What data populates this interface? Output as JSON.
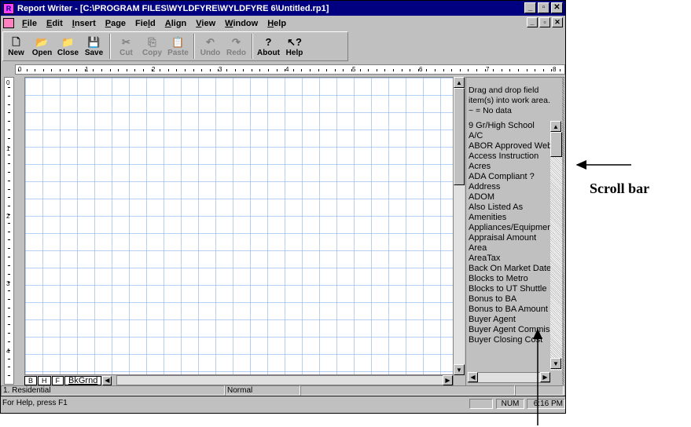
{
  "window": {
    "title": "Report Writer - [C:\\PROGRAM FILES\\WYLDFYRE\\WYLDFYRE 6\\Untitled.rp1]",
    "controls": [
      "_",
      "▫",
      "✕"
    ]
  },
  "menubar": {
    "items": [
      {
        "label": "File",
        "underline": "F"
      },
      {
        "label": "Edit",
        "underline": "E"
      },
      {
        "label": "Insert",
        "underline": "I"
      },
      {
        "label": "Page",
        "underline": "P"
      },
      {
        "label": "Field",
        "underline": "l"
      },
      {
        "label": "Align",
        "underline": "A"
      },
      {
        "label": "View",
        "underline": "V"
      },
      {
        "label": "Window",
        "underline": "W"
      },
      {
        "label": "Help",
        "underline": "H"
      }
    ]
  },
  "toolbar": {
    "buttons": [
      {
        "label": "New",
        "icon": "new-icon",
        "enabled": true
      },
      {
        "label": "Open",
        "icon": "open-icon",
        "enabled": true
      },
      {
        "label": "Close",
        "icon": "close-doc-icon",
        "enabled": true
      },
      {
        "label": "Save",
        "icon": "save-icon",
        "enabled": true
      },
      {
        "label": "Cut",
        "icon": "cut-icon",
        "enabled": false
      },
      {
        "label": "Copy",
        "icon": "copy-icon",
        "enabled": false
      },
      {
        "label": "Paste",
        "icon": "paste-icon",
        "enabled": false
      },
      {
        "label": "Undo",
        "icon": "undo-icon",
        "enabled": false
      },
      {
        "label": "Redo",
        "icon": "redo-icon",
        "enabled": false
      },
      {
        "label": "About",
        "icon": "about-icon",
        "enabled": true
      },
      {
        "label": "Help",
        "icon": "help-icon",
        "enabled": true
      }
    ]
  },
  "ruler": {
    "numbers": [
      "0",
      "1",
      "2",
      "3",
      "4",
      "5",
      "6",
      "7",
      "8"
    ]
  },
  "vruler": {
    "numbers": [
      "0",
      "1",
      "2",
      "3",
      "4"
    ]
  },
  "tabs": [
    "B",
    "H",
    "F",
    "BkGrnd"
  ],
  "panel": {
    "help_line1": "Drag and drop field",
    "help_line2": "item(s) into work area.",
    "help_line3": "~ = No data",
    "fields": [
      "9 Gr/High School",
      "A/C",
      "ABOR Approved Webs",
      "Access Instruction",
      "Acres",
      "ADA Compliant ?",
      "Address",
      "ADOM",
      "Also Listed As",
      "Amenities",
      "Appliances/Equipment",
      "Appraisal Amount",
      "Area",
      "AreaTax",
      "Back On Market Date",
      "Blocks to Metro",
      "Blocks to UT Shuttle",
      "Bonus to BA",
      "Bonus to BA Amount",
      "Buyer Agent",
      "Buyer Agent Commiss",
      "Buyer Closing Cost"
    ]
  },
  "status": {
    "record": "1. Residential",
    "mode": "Normal",
    "help": "For Help, press F1",
    "num": "NUM",
    "time": "6:16 PM"
  },
  "annotation": {
    "label": "Scroll bar"
  }
}
